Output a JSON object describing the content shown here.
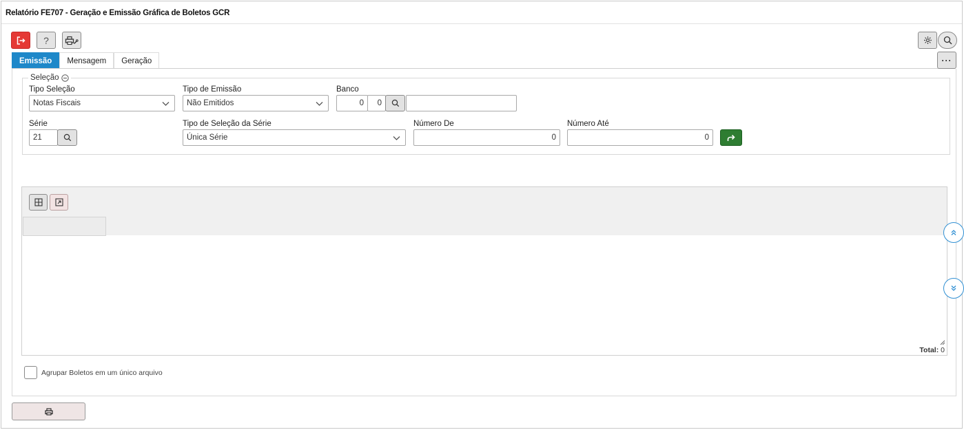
{
  "window": {
    "title": "Relatório FE707 - Geração e Emissão Gráfica de Boletos GCR"
  },
  "toolbar": {
    "exit_icon": "exit-icon",
    "help_icon": "help-icon",
    "help_label": "?",
    "printer_setup_icon": "printer-settings-icon",
    "settings_icon": "gear-icon",
    "search_icon": "search-icon",
    "more_label": "···"
  },
  "tabs": [
    {
      "label": "Emissão",
      "active": true
    },
    {
      "label": "Mensagem",
      "active": false
    },
    {
      "label": "Geração",
      "active": false
    }
  ],
  "selecao": {
    "legend": "Seleção",
    "tipo_selecao": {
      "label": "Tipo Seleção",
      "value": "Notas Fiscais"
    },
    "tipo_emissao": {
      "label": "Tipo de Emissão",
      "value": "Não Emitidos"
    },
    "banco": {
      "label": "Banco",
      "value1": "0",
      "value2": "0",
      "description": ""
    },
    "serie": {
      "label": "Série",
      "value": "21"
    },
    "tipo_selecao_serie": {
      "label": "Tipo de Seleção da Série",
      "value": "Única Série"
    },
    "numero_de": {
      "label": "Número De",
      "value": "0"
    },
    "numero_ate": {
      "label": "Número Até",
      "value": "0"
    }
  },
  "grid": {
    "total_label": "Total:",
    "total_value": "0"
  },
  "options": {
    "agrupar_label": "Agrupar Boletos em um único arquivo",
    "agrupar_checked": false
  },
  "colors": {
    "accent": "#1e88c9",
    "danger": "#e53935",
    "success": "#2e7d32"
  }
}
